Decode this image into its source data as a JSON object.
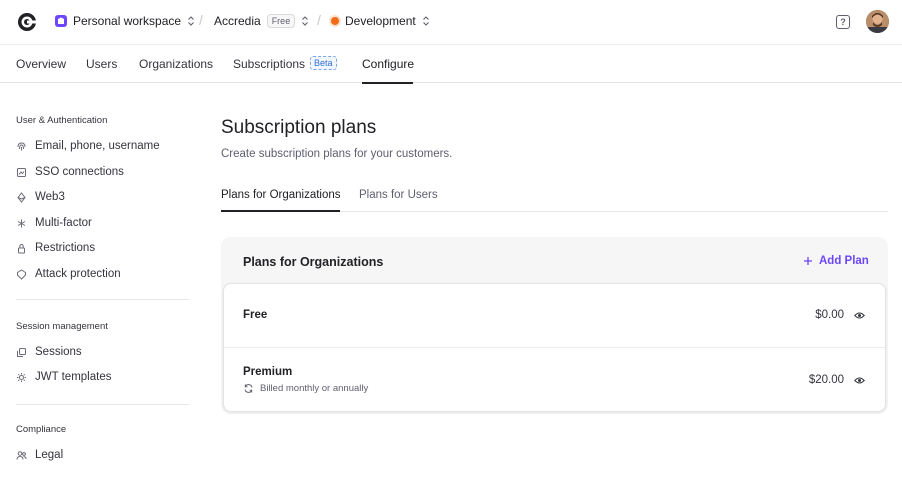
{
  "topbar": {
    "workspace": "Personal workspace",
    "app_name": "Accredia",
    "app_plan": "Free",
    "environment": "Development",
    "help_label": "?"
  },
  "nav": {
    "tabs": [
      "Overview",
      "Users",
      "Organizations",
      "Subscriptions",
      "Configure"
    ],
    "beta_badge": "Beta",
    "active_tab": "Configure"
  },
  "sidebar": {
    "sections": [
      {
        "heading": "User & Authentication",
        "items": [
          {
            "label": "Email, phone, username",
            "icon": "fingerprint-icon"
          },
          {
            "label": "SSO connections",
            "icon": "sso-icon"
          },
          {
            "label": "Web3",
            "icon": "web3-icon"
          },
          {
            "label": "Multi-factor",
            "icon": "asterisk-icon"
          },
          {
            "label": "Restrictions",
            "icon": "lock-icon"
          },
          {
            "label": "Attack protection",
            "icon": "shield-icon"
          }
        ]
      },
      {
        "heading": "Session management",
        "items": [
          {
            "label": "Sessions",
            "icon": "sessions-icon"
          },
          {
            "label": "JWT templates",
            "icon": "gear-icon"
          }
        ]
      },
      {
        "heading": "Compliance",
        "items": [
          {
            "label": "Legal",
            "icon": "users-icon"
          }
        ]
      }
    ]
  },
  "main": {
    "title": "Subscription plans",
    "subtitle": "Create subscription plans for your customers.",
    "tabs": [
      "Plans for Organizations",
      "Plans for Users"
    ],
    "active_tab": "Plans for Organizations",
    "card": {
      "title": "Plans for Organizations",
      "add_label": "Add Plan",
      "plans": [
        {
          "name": "Free",
          "price": "$0.00",
          "billing": ""
        },
        {
          "name": "Premium",
          "price": "$20.00",
          "billing": "Billed monthly or annually"
        }
      ]
    }
  },
  "colors": {
    "accent": "#6c47ff",
    "environment_dot": "#f36b16",
    "beta": "#2f6fd1"
  }
}
